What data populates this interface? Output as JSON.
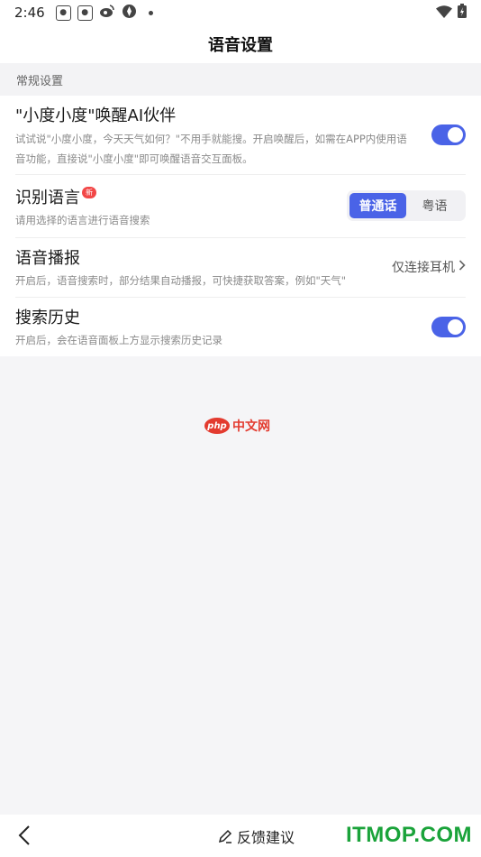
{
  "status_bar": {
    "time": "2:46",
    "notification_icons": [
      "baidu-paw-icon",
      "baidu-paw-icon",
      "weibo-icon",
      "aperture-icon"
    ],
    "system_icons": [
      "wifi-icon",
      "battery-charging-icon"
    ]
  },
  "header": {
    "title": "语音设置"
  },
  "section": {
    "label": "常规设置"
  },
  "settings": {
    "wake": {
      "title": "\"小度小度\"唤醒AI伙伴",
      "desc": "试试说\"小度小度，今天天气如何？\"不用手就能搜。开启唤醒后，如需在APP内使用语音功能，直接说\"小度小度\"即可唤醒语音交互面板。",
      "enabled": true
    },
    "language": {
      "title": "识别语言",
      "badge": "新",
      "desc": "请用选择的语言进行语音搜索",
      "options": [
        "普通话",
        "粤语"
      ],
      "selected": "普通话"
    },
    "broadcast": {
      "title": "语音播报",
      "desc": "开启后，语音搜索时，部分结果自动播报，可快捷获取答案，例如\"天气\"",
      "value": "仅连接耳机"
    },
    "history": {
      "title": "搜索历史",
      "desc": "开启后，会在语音面板上方显示搜索历史记录",
      "enabled": true
    }
  },
  "watermark": {
    "logo": "php",
    "text": "中文网"
  },
  "bottom": {
    "feedback_label": "反馈建议",
    "site_mark": "ITMOP.COM"
  },
  "colors": {
    "accent": "#4a63e7",
    "badge": "#f24747",
    "watermark_red": "#e33b2f",
    "site_green": "#1aa33a"
  }
}
